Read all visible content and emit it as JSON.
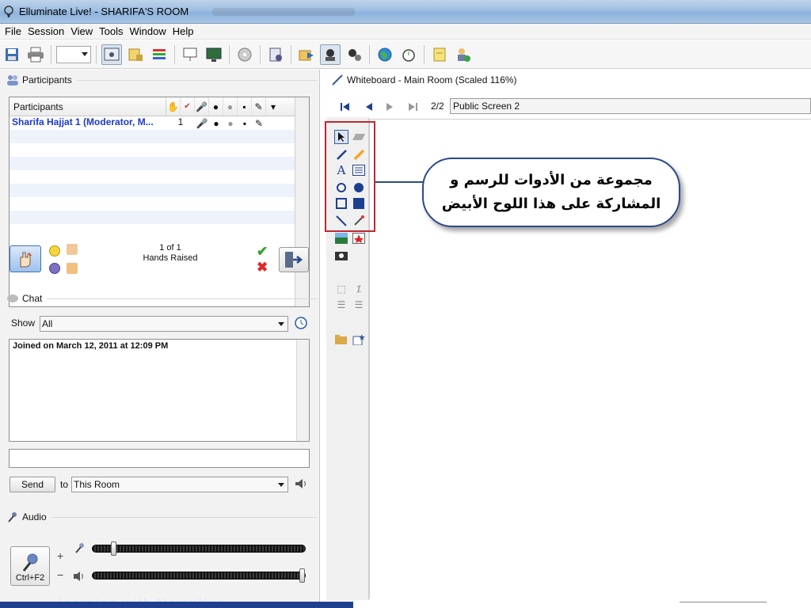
{
  "window": {
    "title": "Elluminate Live! - SHARIFA'S ROOM"
  },
  "menu": [
    "File",
    "Session",
    "View",
    "Tools",
    "Window",
    "Help"
  ],
  "participants": {
    "header": "Participants",
    "column_name": "Participants",
    "rows": [
      {
        "name": "Sharifa Hajjat 1 (Moderator, M...",
        "count": "1"
      }
    ],
    "hands_count": "1 of 1",
    "hands_label": "Hands Raised"
  },
  "chat": {
    "header": "Chat",
    "show_label": "Show",
    "show_value": "All",
    "log": "Joined on March 12, 2011 at 12:09 PM",
    "input_value": "",
    "send_label": "Send",
    "to_label": "to",
    "room_value": "This Room"
  },
  "audio": {
    "header": "Audio",
    "talk_label": "Ctrl+F2",
    "plus": "+",
    "minus": "−",
    "mic_level": 0.09,
    "speaker_level": 1.0
  },
  "whiteboard": {
    "header": "Whiteboard - Main Room (Scaled 116%)",
    "page": "2/2",
    "screen": "Public Screen 2"
  },
  "callout": {
    "line1": "مجموعة من الأدوات للرسم و",
    "line2": "المشاركة على هذا اللوح الأبيض"
  },
  "footer": {
    "text": "..... learning with NomuNyo..."
  },
  "colors": {
    "moderator_name": "#1b3bc9",
    "highlight": "#c1272d",
    "callout_border": "#2a4a8a"
  }
}
